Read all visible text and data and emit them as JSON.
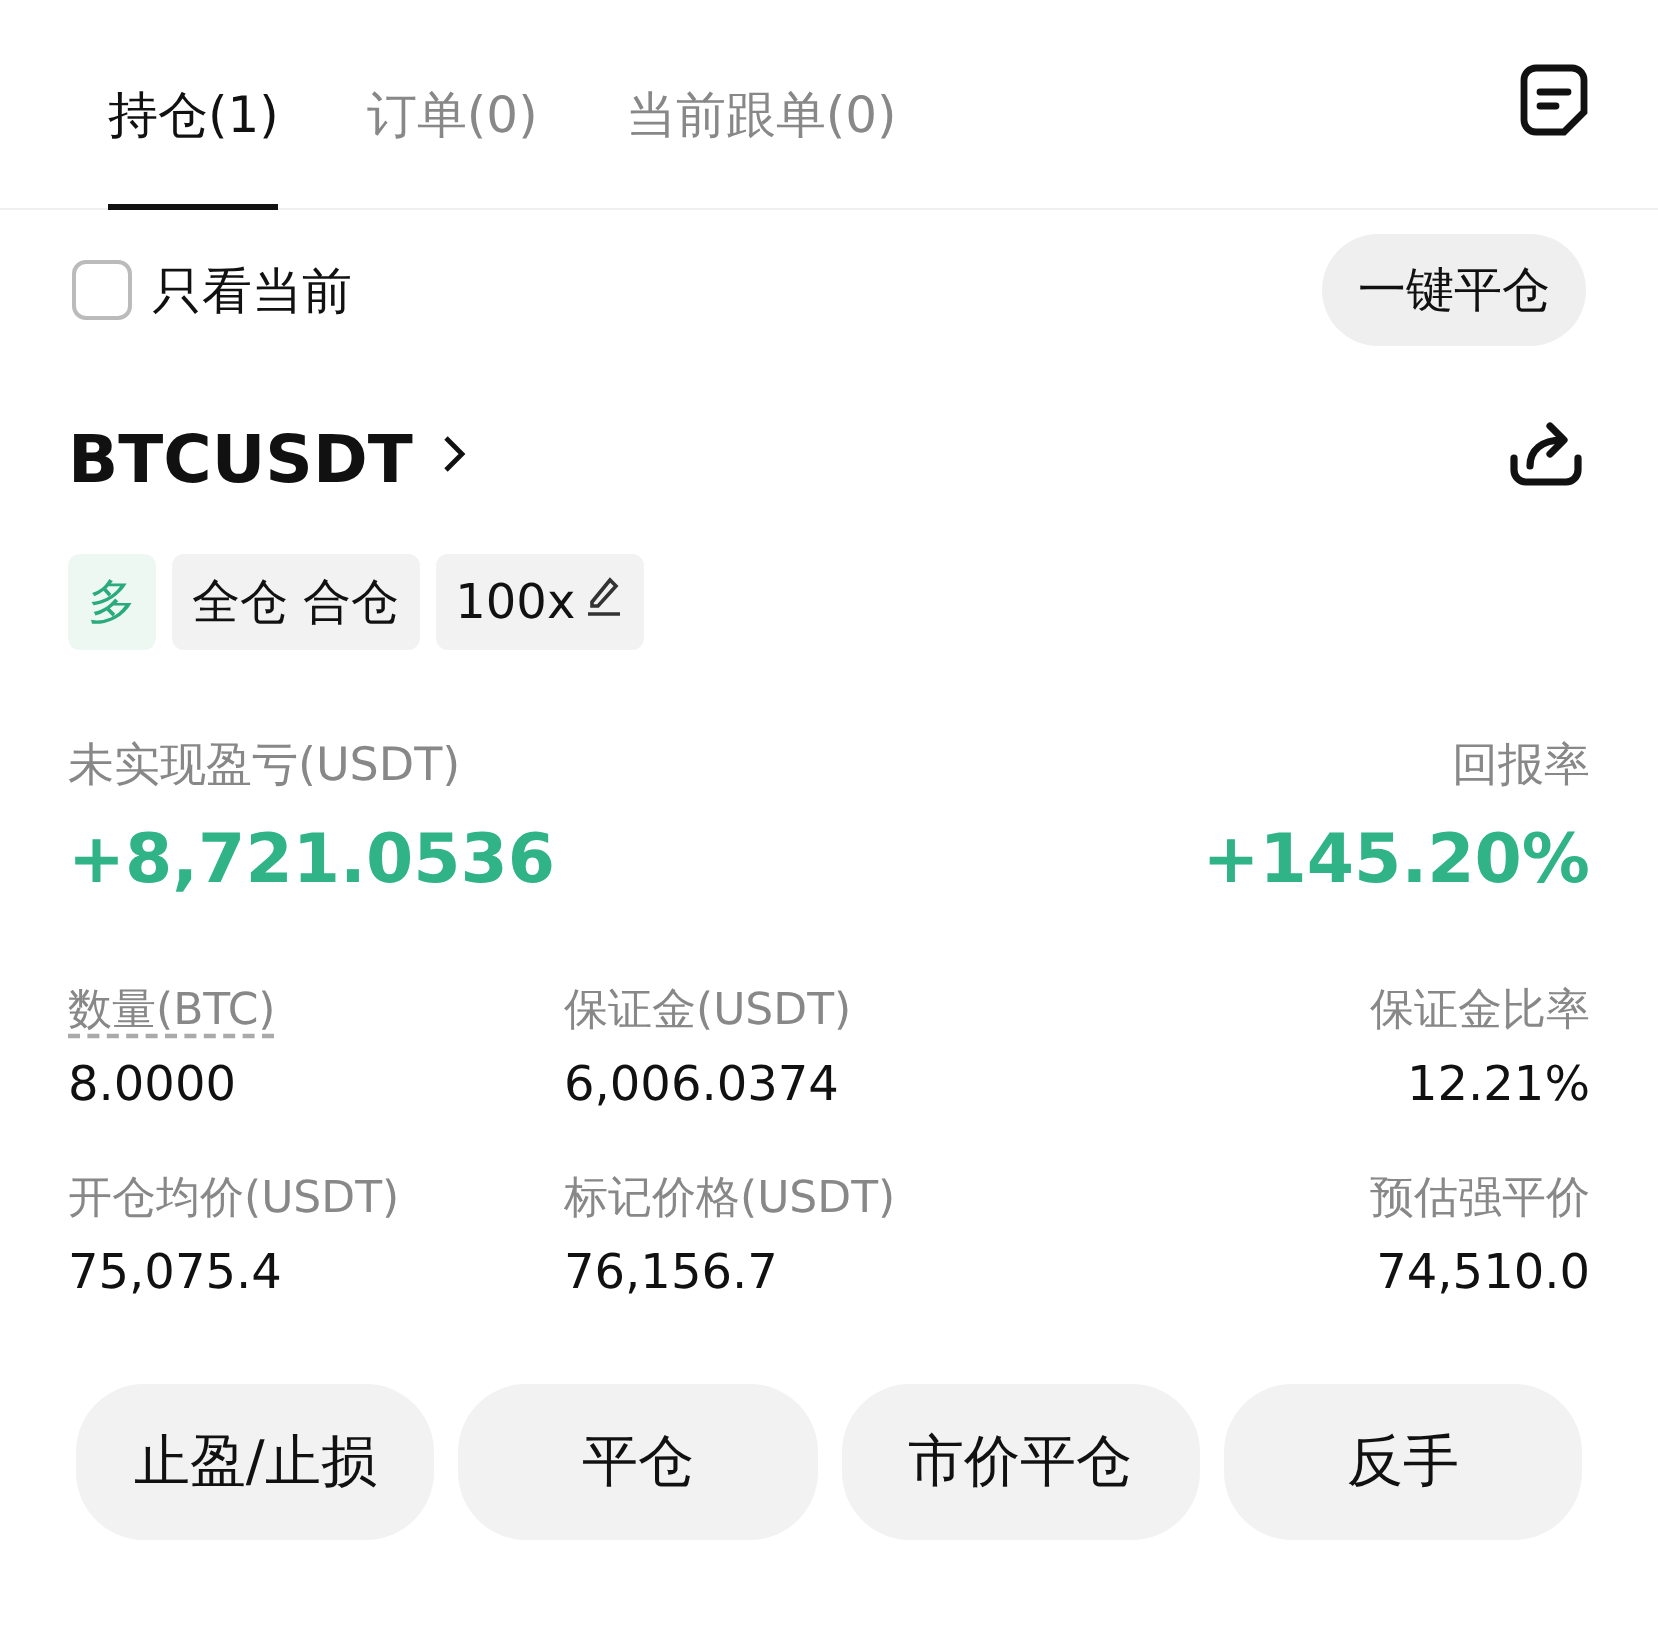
{
  "tabs": [
    {
      "label": "持仓(1)",
      "selected": true
    },
    {
      "label": "订单(0)",
      "selected": false
    },
    {
      "label": "当前跟单(0)",
      "selected": false
    }
  ],
  "filter": {
    "label": "只看当前",
    "checked": false
  },
  "close_all_button": "一键平仓",
  "position": {
    "symbol": "BTCUSDT",
    "tags": [
      {
        "kind": "side",
        "label": "多"
      },
      {
        "kind": "mode",
        "label": "全仓 合仓"
      },
      {
        "kind": "leverage",
        "label": "100x"
      }
    ],
    "pnl": {
      "label": "未实现盈亏(USDT)",
      "value": "+8,721.0536"
    },
    "roe": {
      "label": "回报率",
      "value": "+145.20%"
    },
    "stats": [
      {
        "label": "数量(BTC)",
        "value": "8.0000",
        "underlined": true
      },
      {
        "label": "保证金(USDT)",
        "value": "6,006.0374",
        "underlined": false
      },
      {
        "label": "保证金比率",
        "value": "12.21%",
        "underlined": false
      },
      {
        "label": "开仓均价(USDT)",
        "value": "75,075.4",
        "underlined": false
      },
      {
        "label": "标记价格(USDT)",
        "value": "76,156.7",
        "underlined": false
      },
      {
        "label": "预估强平价",
        "value": "74,510.0",
        "underlined": false
      }
    ],
    "actions": [
      "止盈/止损",
      "平仓",
      "市价平仓",
      "反手"
    ]
  }
}
